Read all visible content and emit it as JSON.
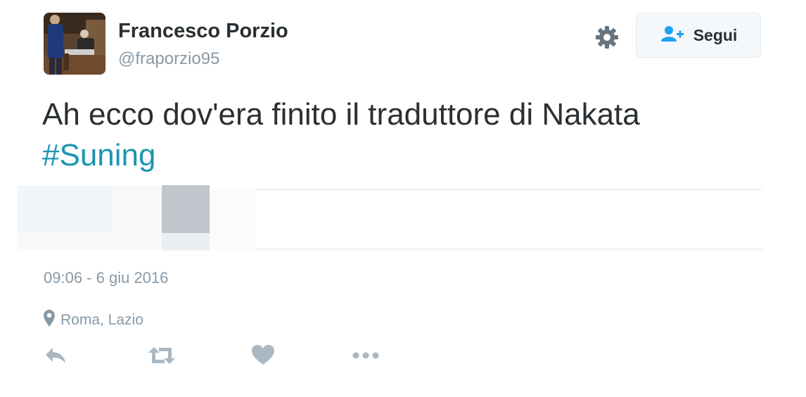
{
  "author": {
    "name": "Francesco Porzio",
    "handle": "@fraporzio95"
  },
  "follow_button": {
    "label": "Segui",
    "icon": "follow-person-icon"
  },
  "settings": {
    "icon": "gear-icon"
  },
  "tweet": {
    "text": "Ah ecco dov'era finito il traduttore di Nakata",
    "hashtag": "#Suning"
  },
  "meta": {
    "timestamp": "09:06 - 6 giu 2016",
    "location": "Roma, Lazio",
    "location_icon": "location-pin-icon"
  },
  "actions": [
    {
      "name": "reply",
      "icon": "reply-icon"
    },
    {
      "name": "retweet",
      "icon": "retweet-icon"
    },
    {
      "name": "like",
      "icon": "heart-icon"
    },
    {
      "name": "more",
      "icon": "more-dots-icon"
    }
  ],
  "colors": {
    "text": "#292f33",
    "muted": "#8899a6",
    "hashtag": "#1b95b0",
    "follow_icon": "#1da1f2",
    "action_icon": "#aab8c2"
  }
}
